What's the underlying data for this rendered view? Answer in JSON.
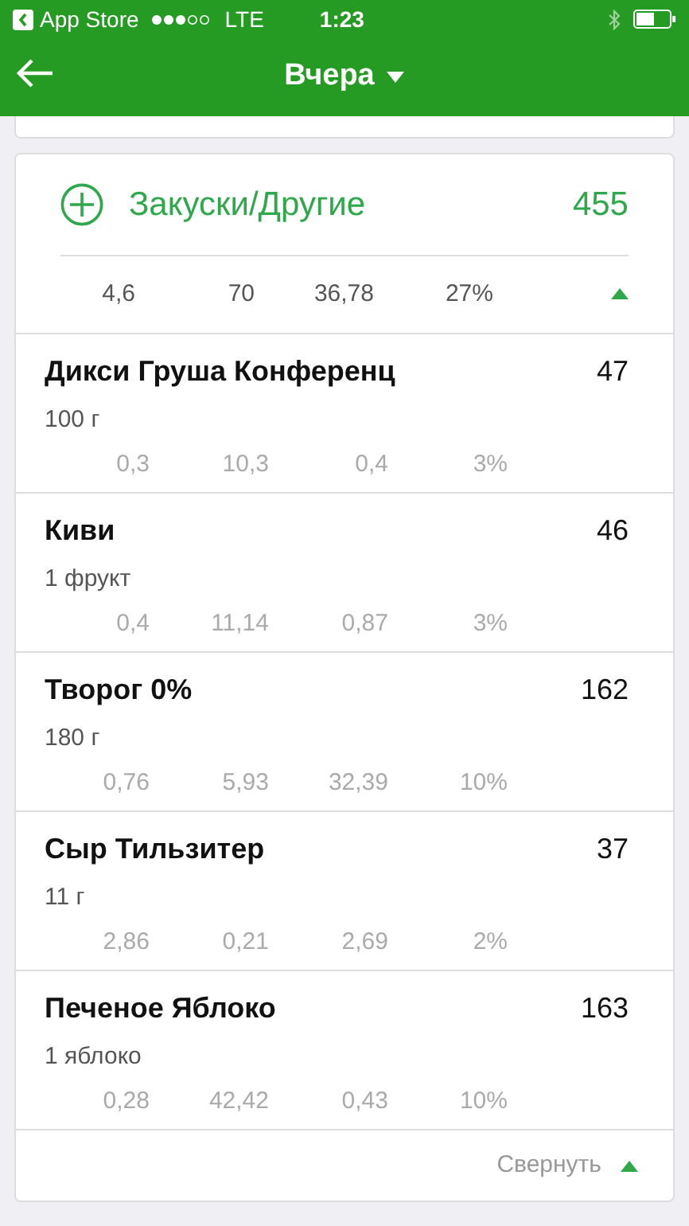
{
  "status_bar": {
    "back_app": "App Store",
    "network": "LTE",
    "time": "1:23"
  },
  "header": {
    "title": "Вчера"
  },
  "meal": {
    "title": "Закуски/Другие",
    "calories": "455",
    "totals": [
      "4,6",
      "70",
      "36,78",
      "27%"
    ],
    "expanded": true,
    "items": [
      {
        "name": "Дикси Груша Конференц",
        "calories": "47",
        "serving": "100 г",
        "nutrients": [
          "0,3",
          "10,3",
          "0,4",
          "3%"
        ]
      },
      {
        "name": "Киви",
        "calories": "46",
        "serving": "1 фрукт",
        "nutrients": [
          "0,4",
          "11,14",
          "0,87",
          "3%"
        ]
      },
      {
        "name": "Творог 0%",
        "calories": "162",
        "serving": "180 г",
        "nutrients": [
          "0,76",
          "5,93",
          "32,39",
          "10%"
        ]
      },
      {
        "name": "Сыр Тильзитер",
        "calories": "37",
        "serving": "11 г",
        "nutrients": [
          "2,86",
          "0,21",
          "2,69",
          "2%"
        ]
      },
      {
        "name": "Печеное Яблоко",
        "calories": "163",
        "serving": "1 яблоко",
        "nutrients": [
          "0,28",
          "42,42",
          "0,43",
          "10%"
        ]
      }
    ],
    "collapse_label": "Свернуть"
  }
}
